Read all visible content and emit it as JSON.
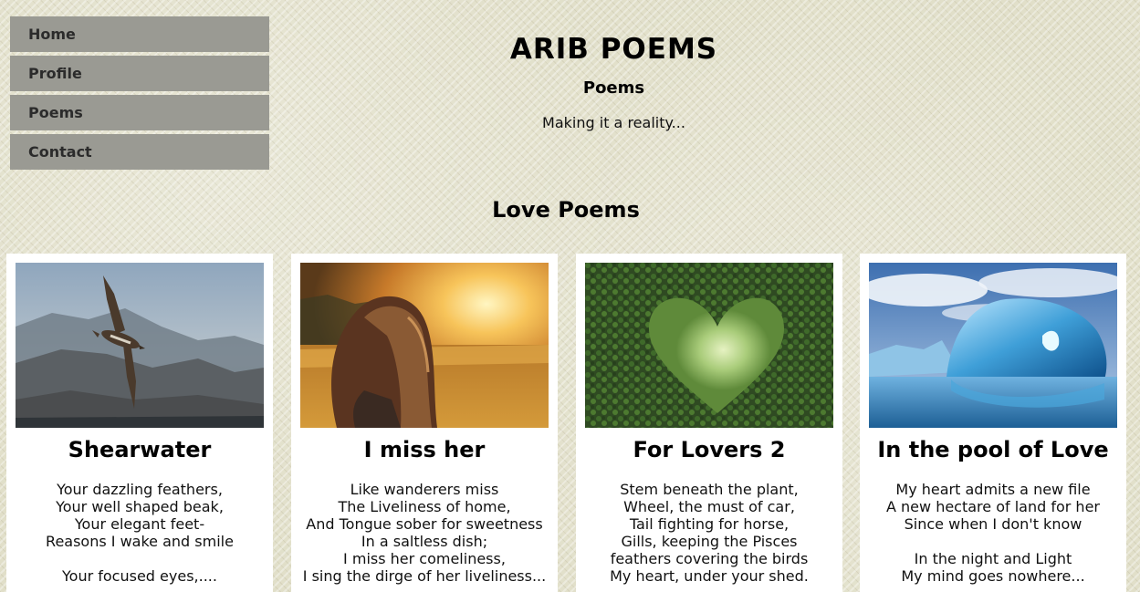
{
  "nav": {
    "items": [
      {
        "label": "Home"
      },
      {
        "label": "Profile"
      },
      {
        "label": "Poems"
      },
      {
        "label": "Contact"
      }
    ]
  },
  "header": {
    "title": "ARIB POEMS",
    "subtitle": "Poems",
    "tagline": "Making it a reality..."
  },
  "section": {
    "heading": "Love Poems"
  },
  "cards": [
    {
      "title": "Shearwater",
      "body": "Your dazzling feathers,\nYour well shaped beak,\nYour elegant feet-\nReasons I wake and smile\n\nYour focused eyes,....",
      "image_icon": "seabird-photo-icon"
    },
    {
      "title": "I miss her",
      "body": "Like wanderers miss\nThe Liveliness of home,\nAnd Tongue sober for sweetness\nIn a saltless dish;\nI miss her comeliness,\nI sing the dirge of her liveliness...",
      "image_icon": "girl-sunset-photo-icon"
    },
    {
      "title": "For Lovers 2",
      "body": "Stem beneath the plant,\nWheel, the must of car,\nTail fighting for horse,\nGills, keeping the Pisces\nfeathers covering the birds\nMy heart, under your shed.",
      "image_icon": "heart-hedge-photo-icon"
    },
    {
      "title": "In the pool of Love",
      "body": "My heart admits a new file\nA new hectare of land for her\nSince when I don't know\n\nIn the night and Light\nMy mind goes nowhere...",
      "image_icon": "iceberg-photo-icon"
    }
  ]
}
